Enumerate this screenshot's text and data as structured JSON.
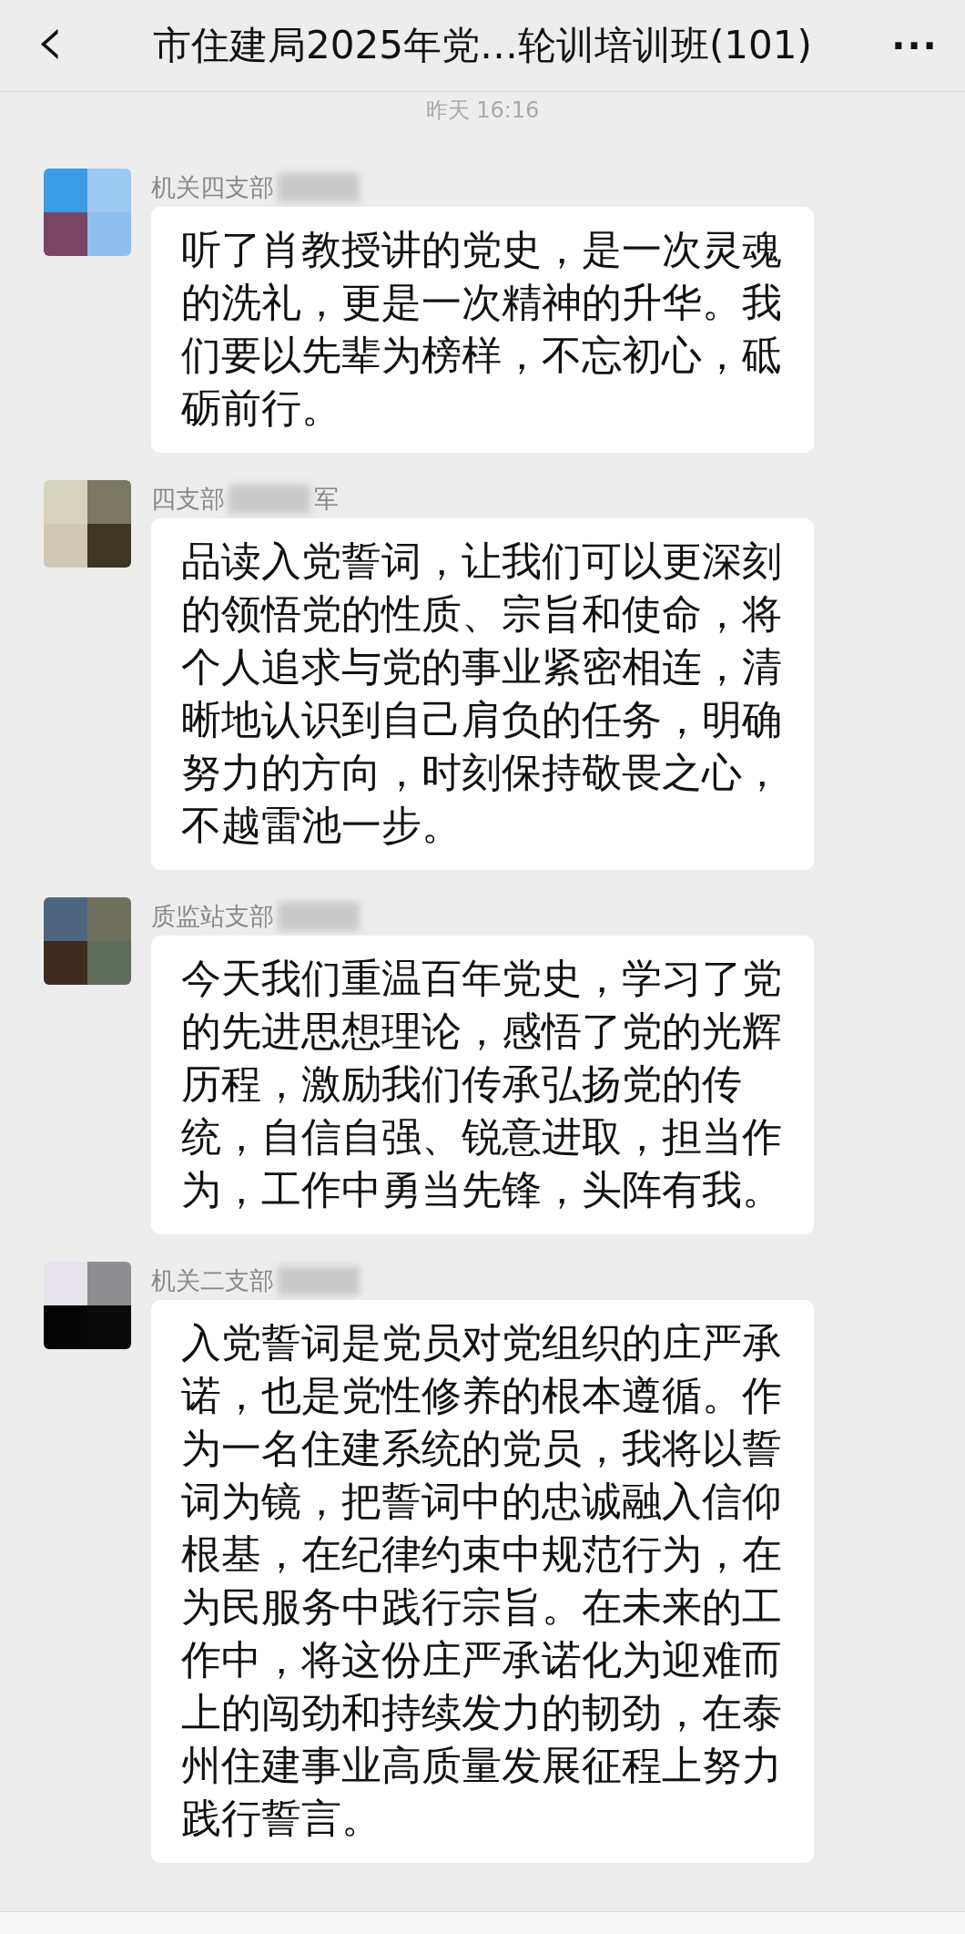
{
  "header": {
    "back": "‹",
    "title": "市住建局2025年党…轮训培训班(101)",
    "more": "···"
  },
  "timestamp": "昨天 16:16",
  "messages": [
    {
      "sender": "机关四支部",
      "redacted": true,
      "text": "听了肖教授讲的党史，是一次灵魂的洗礼，更是一次精神的升华。我们要以先辈为榜样，不忘初心，砥砺前行。"
    },
    {
      "sender": "四支部",
      "sender_tail": "军",
      "redacted": true,
      "text": "品读入党誓词，让我们可以更深刻的领悟党的性质、宗旨和使命，将个人追求与党的事业紧密相连，清晰地认识到自己肩负的任务，明确努力的方向，时刻保持敬畏之心，不越雷池一步。"
    },
    {
      "sender": "质监站支部",
      "redacted": true,
      "text": "今天我们重温百年党史，学习了党的先进思想理论，感悟了党的光辉历程，激励我们传承弘扬党的传统，自信自强、锐意进取，担当作为，工作中勇当先锋，头阵有我。"
    },
    {
      "sender": "机关二支部",
      "redacted": true,
      "text": "入党誓词是党员对党组织的庄严承诺，也是党性修养的根本遵循。作为一名住建系统的党员，我将以誓词为镜，把誓词中的忠诚融入信仰根基，在纪律约束中规范行为，在为民服务中践行宗旨。在未来的工作中，将这份庄严承诺化为迎难而上的闯劲和持续发力的韧劲，在泰州住建事业高质量发展征程上努力践行誓言。"
    }
  ]
}
